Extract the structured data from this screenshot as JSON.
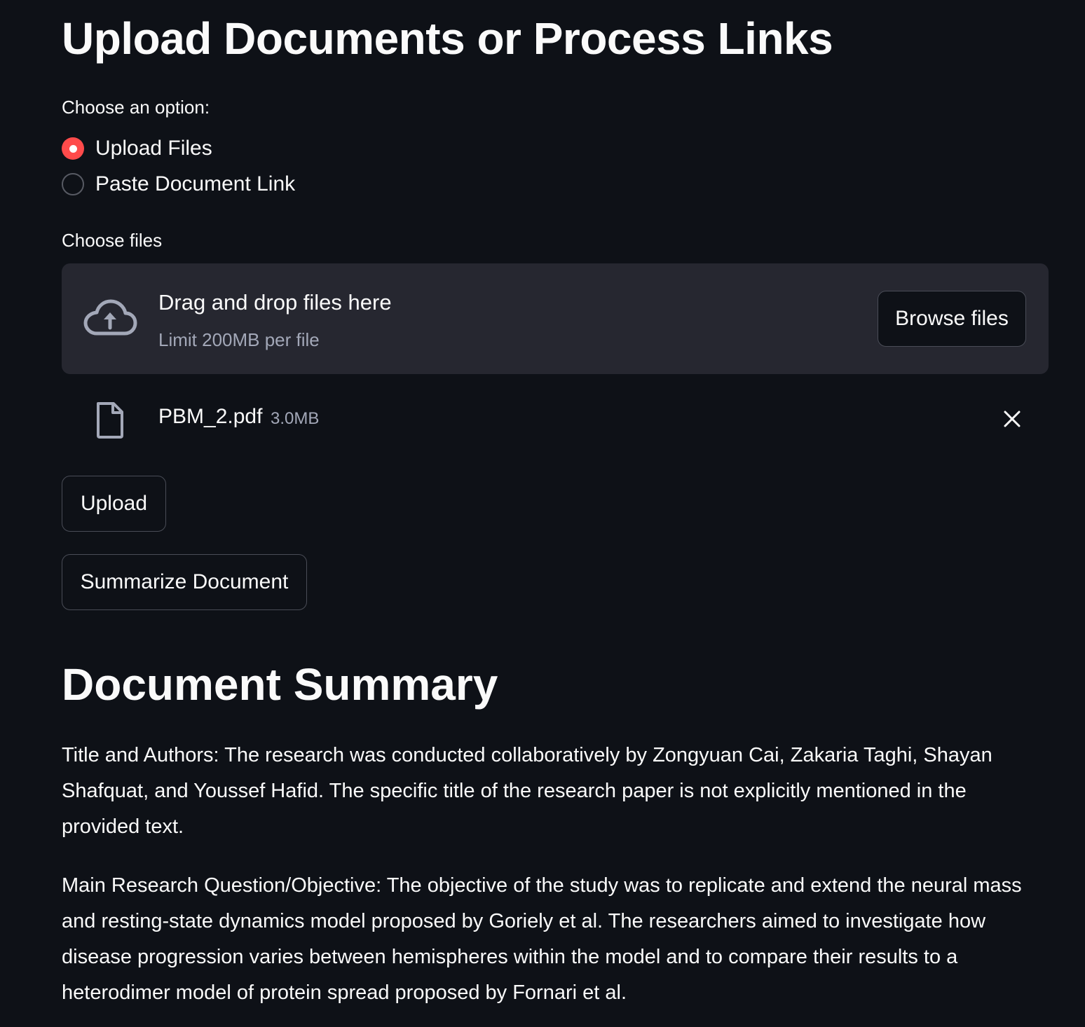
{
  "header": {
    "title": "Upload Documents or Process Links"
  },
  "option_group": {
    "label": "Choose an option:",
    "options": [
      {
        "label": "Upload Files",
        "selected": true
      },
      {
        "label": "Paste Document Link",
        "selected": false
      }
    ]
  },
  "file_uploader": {
    "label": "Choose files",
    "drag_text": "Drag and drop files here",
    "limit_text": "Limit 200MB per file",
    "browse_label": "Browse files",
    "files": [
      {
        "name": "PBM_2.pdf",
        "size": "3.0MB"
      }
    ]
  },
  "actions": {
    "upload_label": "Upload",
    "summarize_label": "Summarize Document"
  },
  "summary": {
    "title": "Document Summary",
    "paragraphs": [
      "Title and Authors: The research was conducted collaboratively by Zongyuan Cai, Zakaria Taghi, Shayan Shafquat, and Youssef Hafid. The specific title of the research paper is not explicitly mentioned in the provided text.",
      "Main Research Question/Objective: The objective of the study was to replicate and extend the neural mass and resting-state dynamics model proposed by Goriely et al. The researchers aimed to investigate how disease progression varies between hemispheres within the model and to compare their results to a heterodimer model of protein spread proposed by Fornari et al."
    ]
  },
  "colors": {
    "background": "#0e1117",
    "accent": "#ff4b4b",
    "surface": "#262730",
    "muted_text": "#a3a8b8"
  },
  "icons": {
    "upload": "cloud-upload-icon",
    "file": "file-icon",
    "remove": "close-icon"
  }
}
